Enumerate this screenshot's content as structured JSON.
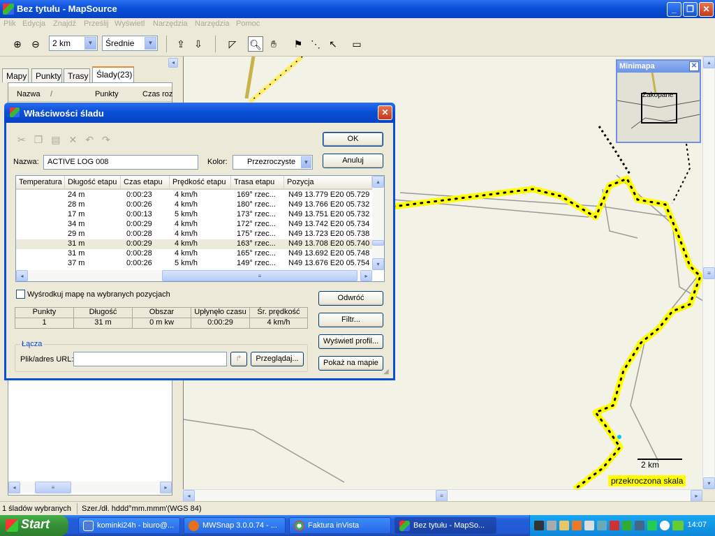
{
  "window": {
    "title": "Bez tytułu - MapSource",
    "controls": [
      "_",
      "❐",
      "✕"
    ]
  },
  "menu": [
    "Plik",
    "Edycja",
    "Znajdź",
    "Prześlij",
    "Wyświetl",
    "Narzędzia",
    "Narzędzia",
    "Pomoc"
  ],
  "toolbar": {
    "zoom_scale": "2 km",
    "detail": "Średnie"
  },
  "tabs": [
    "Mapy",
    "Punkty",
    "Trasy",
    "Ślady(23)"
  ],
  "tracklist": {
    "col_name": "Nazwa",
    "col_sort": "/",
    "col_points": "Punkty",
    "col_time": "Czas roz"
  },
  "minimap": {
    "title": "Minimapa",
    "place": "Zakopane"
  },
  "map": {
    "scale_label": "2 km",
    "scale_warning": "przekroczona skala"
  },
  "dialog": {
    "title": "Właściwości śladu",
    "name_label": "Nazwa:",
    "name_value": "ACTIVE LOG 008",
    "color_label": "Kolor:",
    "color_value": "Przezroczyste",
    "ok": "OK",
    "cancel": "Anuluj",
    "columns": [
      "Temperatura",
      "Długość etapu",
      "Czas etapu",
      "Prędkość etapu",
      "Trasa etapu",
      "Pozycja"
    ],
    "rows": [
      [
        "",
        "24 m",
        "0:00:23",
        "4 km/h",
        "169° rzec...",
        "N49 13.779 E20 05.729"
      ],
      [
        "",
        "28 m",
        "0:00:26",
        "4 km/h",
        "180° rzec...",
        "N49 13.766 E20 05.732"
      ],
      [
        "",
        "17 m",
        "0:00:13",
        "5 km/h",
        "173° rzec...",
        "N49 13.751 E20 05.732"
      ],
      [
        "",
        "34 m",
        "0:00:29",
        "4 km/h",
        "172° rzec...",
        "N49 13.742 E20 05.734"
      ],
      [
        "",
        "29 m",
        "0:00:28",
        "4 km/h",
        "175° rzec...",
        "N49 13.723 E20 05.738"
      ],
      [
        "",
        "31 m",
        "0:00:29",
        "4 km/h",
        "163° rzec...",
        "N49 13.708 E20 05.740"
      ],
      [
        "",
        "31 m",
        "0:00:28",
        "4 km/h",
        "165° rzec...",
        "N49 13.692 E20 05.748"
      ],
      [
        "",
        "37 m",
        "0:00:26",
        "5 km/h",
        "149° rzec...",
        "N49 13.676 E20 05.754"
      ]
    ],
    "selected_row": 5,
    "center_checkbox": "Wyśrodkuj mapę na wybranych pozycjach",
    "stats_headers": [
      "Punkty",
      "Długość",
      "Obszar",
      "Upłynęło czasu",
      "Śr. prędkość"
    ],
    "stats_values": [
      "1",
      "31 m",
      "0 m kw",
      "0:00:29",
      "4 km/h"
    ],
    "links_group": "Łącza",
    "url_label": "Plik/adres URL:",
    "url_value": "",
    "browse": "Przeglądaj...",
    "reverse": "Odwróć",
    "filter": "Filtr...",
    "show_profile": "Wyświetl profil...",
    "show_on_map": "Pokaż na mapie"
  },
  "status": {
    "selected": "1 śladów wybranych",
    "coords": "Szer./dł. hddd°mm.mmm'(WGS 84)"
  },
  "taskbar": {
    "start": "Start",
    "tasks": [
      "kominki24h - biuro@...",
      "MWSnap 3.0.0.74 - ...",
      "Faktura inVista",
      "Bez tytułu - MapSo..."
    ],
    "active_task": 3,
    "clock": "14:07"
  },
  "colors": {
    "title_blue": "#0a4fd8",
    "track_yellow": "#ffff00",
    "start_green": "#358f35"
  }
}
